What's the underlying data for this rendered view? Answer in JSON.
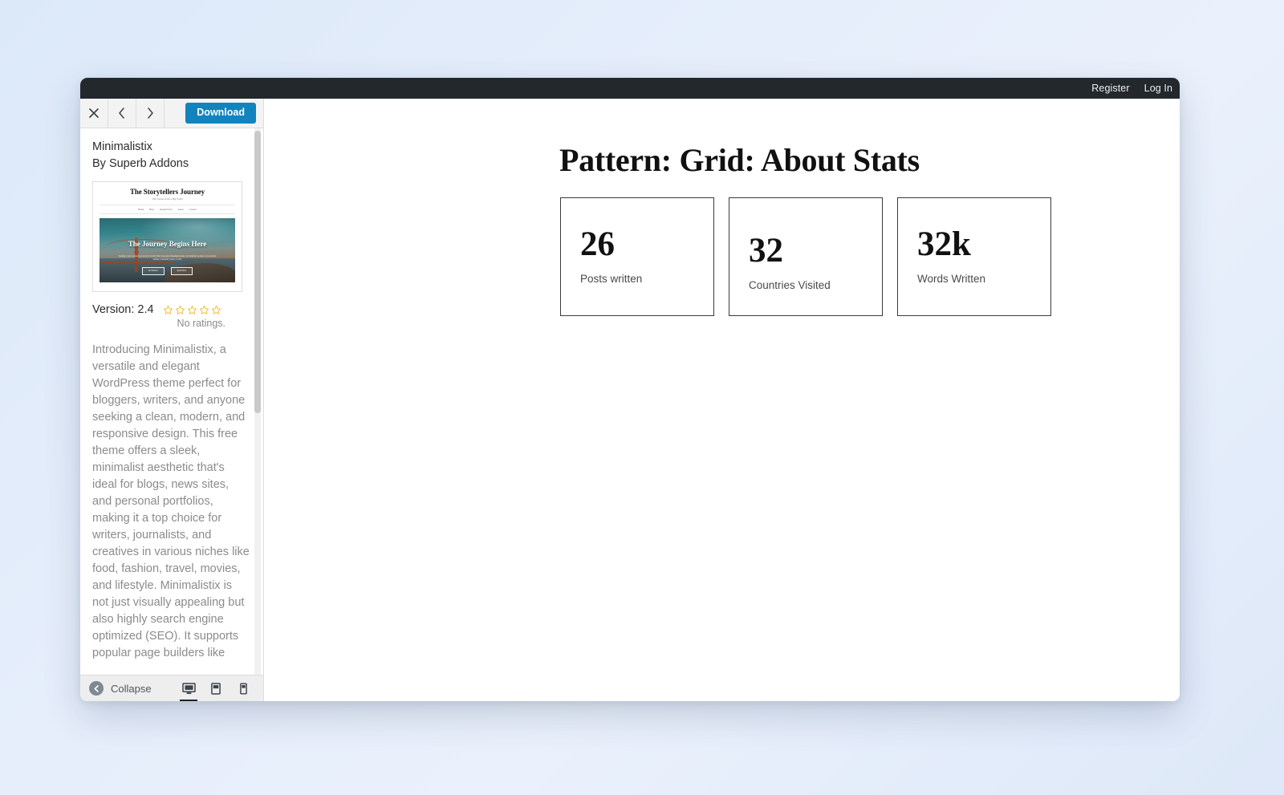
{
  "adminbar": {
    "links": [
      {
        "label": "Register"
      },
      {
        "label": "Log In"
      }
    ]
  },
  "sidebar": {
    "toolbar": {
      "close_icon": "close-icon",
      "prev_icon": "chevron-left-icon",
      "next_icon": "chevron-right-icon",
      "download_label": "Download"
    },
    "theme": {
      "name": "Minimalistix",
      "author": "By Superb Addons",
      "version_label": "Version: 2.4",
      "rating_count": 5,
      "rating_filled": 0,
      "no_ratings_label": "No ratings.",
      "description": "Introducing Minimalistix, a versatile and elegant WordPress theme perfect for bloggers, writers, and anyone seeking a clean, modern, and responsive design. This free theme offers a sleek, minimalist aesthetic that's ideal for blogs, news sites, and personal portfolios, making it a top choice for writers, journalists, and creatives in various niches like food, fashion, travel, movies, and lifestyle. Minimalistix is not just visually appealing but also highly search engine optimized (SEO). It supports popular page builders like"
    },
    "screenshot": {
      "site_title": "The Storytellers Journey",
      "tagline": "Tiny Stories from a Big World",
      "nav": [
        "Home",
        "Blog",
        "Popular Posts",
        "About",
        "Contact"
      ],
      "hero_heading": "The Journey Begins Here",
      "hero_text": "Seeking a way to share your story by travel? Life's long and exhausting journey can transform us most; you can have making a beautiful journey it with.",
      "hero_buttons": [
        "Get Started",
        "Read More"
      ]
    },
    "footer": {
      "collapse_label": "Collapse",
      "collapse_icon": "collapse-arrow-icon",
      "devices": [
        {
          "name": "desktop-preview",
          "icon": "desktop-icon",
          "active": true
        },
        {
          "name": "tablet-preview",
          "icon": "tablet-icon",
          "active": false
        },
        {
          "name": "mobile-preview",
          "icon": "mobile-icon",
          "active": false
        }
      ]
    }
  },
  "preview": {
    "pattern_title": "Pattern: Grid: About Stats",
    "stats": [
      {
        "value": "26",
        "label": "Posts written"
      },
      {
        "value": "32",
        "label": "Countries Visited"
      },
      {
        "value": "32k",
        "label": "Words Written"
      }
    ]
  },
  "colors": {
    "accent": "#1184bd",
    "adminbar_bg": "#23282d",
    "star": "#e8b931",
    "page_bg": "#e3ecfa"
  }
}
